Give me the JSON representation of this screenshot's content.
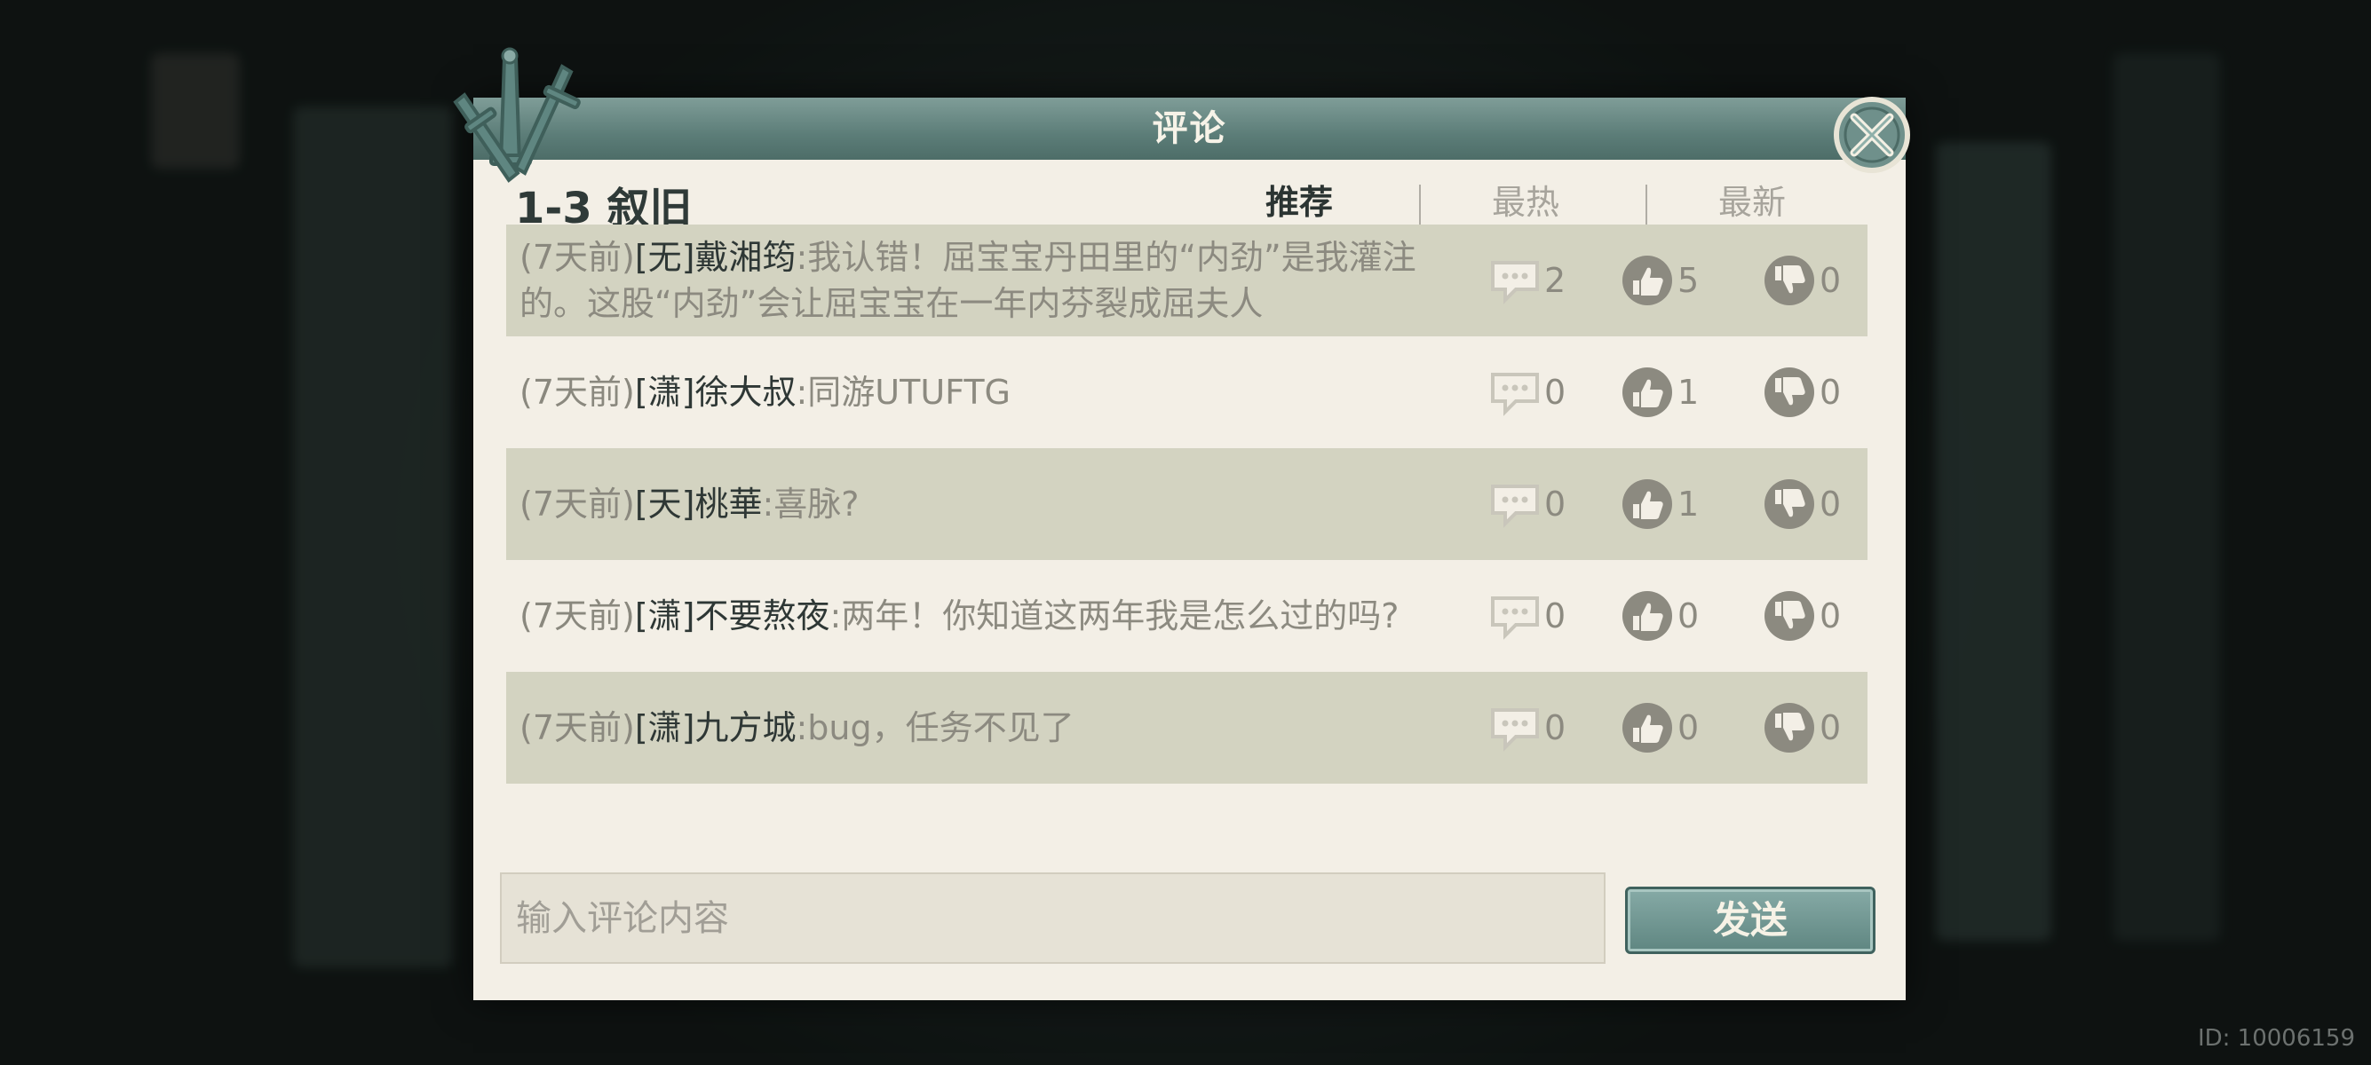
{
  "dialog": {
    "title": "评论",
    "section_title": "1-3 叙旧",
    "tabs": [
      {
        "label": "推荐",
        "active": true
      },
      {
        "label": "最热",
        "active": false
      },
      {
        "label": "最新",
        "active": false
      }
    ],
    "comments": [
      {
        "time": "(7天前)",
        "user": "[无]戴湘筠",
        "text": ":我认错！屈宝宝丹田里的“内劲”是我灌注的。这股“内劲”会让屈宝宝在一年内芬裂成屈夫人",
        "replies": "2",
        "likes": "5",
        "dislikes": "0"
      },
      {
        "time": "(7天前)",
        "user": "[潇]徐大叔",
        "text": ":同游UTUFTG",
        "replies": "0",
        "likes": "1",
        "dislikes": "0"
      },
      {
        "time": "(7天前)",
        "user": "[天]桃華",
        "text": ":喜脉?",
        "replies": "0",
        "likes": "1",
        "dislikes": "0"
      },
      {
        "time": "(7天前)",
        "user": "[潇]不要熬夜",
        "text": ":两年！你知道这两年我是怎么过的吗?",
        "replies": "0",
        "likes": "0",
        "dislikes": "0"
      },
      {
        "time": "(7天前)",
        "user": "[潇]九方城",
        "text": ":bug，任务不见了",
        "replies": "0",
        "likes": "0",
        "dislikes": "0"
      }
    ],
    "input_placeholder": "输入评论内容",
    "send_label": "发送",
    "icons": {
      "close": "close-x-icon",
      "reply": "speech-bubble-icon",
      "like": "thumbs-up-icon",
      "dislike": "thumbs-down-icon"
    }
  },
  "footer": {
    "user_id": "ID: 10006159"
  },
  "colors": {
    "accent_teal": "#5c7d78",
    "panel_bg": "#f3efe6",
    "row_shade": "#d3d3c1",
    "icon_gray": "#8c8a80"
  }
}
